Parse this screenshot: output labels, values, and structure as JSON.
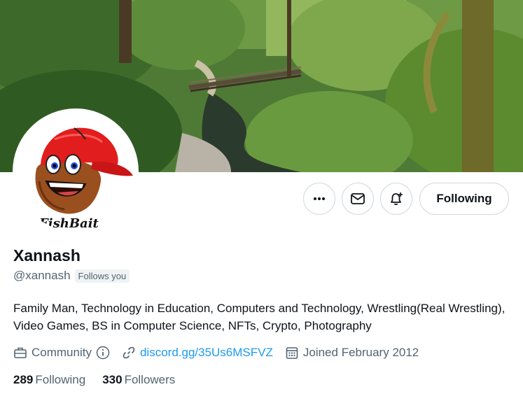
{
  "banner": {
    "icon": "forest-bridge-photo"
  },
  "avatar": {
    "logo_text": "FishBait",
    "icon": "cartoon-mascot-red-cap"
  },
  "actions": {
    "more_icon": "more-horizontal-icon",
    "message_icon": "envelope-icon",
    "notify_icon": "bell-plus-icon",
    "following_label": "Following"
  },
  "profile": {
    "display_name": "Xannash",
    "handle": "@xannash",
    "follows_you": "Follows you",
    "bio": "Family Man, Technology in Education, Computers and Technology, Wrestling(Real Wrestling), Video Games, BS in Computer Science, NFTs, Crypto, Photography",
    "category": "Community",
    "link": "discord.gg/35Us6MSFVZ",
    "joined": "Joined February 2012"
  },
  "stats": {
    "following_count": "289",
    "following_label": "Following",
    "followers_count": "330",
    "followers_label": "Followers"
  },
  "colors": {
    "link": "#1d9bf0",
    "muted": "#536471",
    "text": "#0f1419",
    "border": "#cfd9de"
  }
}
